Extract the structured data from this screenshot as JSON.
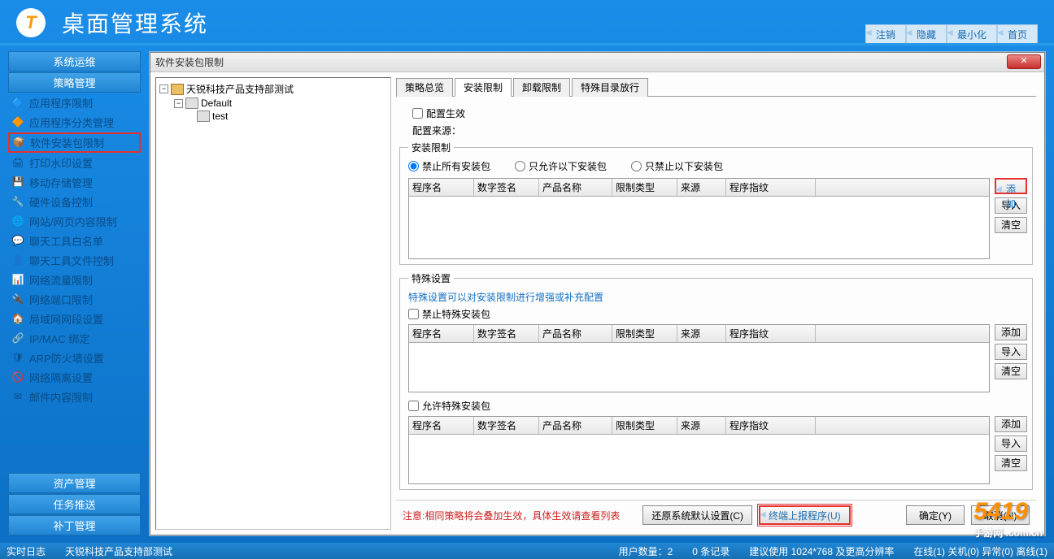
{
  "app": {
    "title": "桌面管理系统"
  },
  "header_links": [
    "注销",
    "隐藏",
    "最小化",
    "首页"
  ],
  "sidebar": {
    "top_headers": [
      "系统运维",
      "策略管理"
    ],
    "items": [
      {
        "label": "应用程序限制"
      },
      {
        "label": "应用程序分类管理"
      },
      {
        "label": "软件安装包限制",
        "highlight": true
      },
      {
        "label": "打印水印设置"
      },
      {
        "label": "移动存储管理"
      },
      {
        "label": "硬件设备控制"
      },
      {
        "label": "网站/网页内容限制"
      },
      {
        "label": "聊天工具白名单"
      },
      {
        "label": "聊天工具文件控制"
      },
      {
        "label": "网络流量限制"
      },
      {
        "label": "网络端口限制"
      },
      {
        "label": "局域网网段设置"
      },
      {
        "label": "IP/MAC 绑定"
      },
      {
        "label": "ARP防火墙设置"
      },
      {
        "label": "网络隔离设置"
      },
      {
        "label": "邮件内容限制"
      }
    ],
    "bottom_headers": [
      "资产管理",
      "任务推送",
      "补丁管理"
    ]
  },
  "dialog": {
    "title": "软件安装包限制",
    "tree": {
      "root": "天锐科技产品支持部测试",
      "child1": "Default",
      "leaf": "test"
    },
    "tabs": [
      "策略总览",
      "安装限制",
      "卸载限制",
      "特殊目录放行"
    ],
    "active_tab": 1,
    "config_effective_label": "配置生效",
    "config_source_label": "配置来源：",
    "install_restrict": {
      "legend": "安装限制",
      "radios": [
        "禁止所有安装包",
        "只允许以下安装包",
        "只禁止以下安装包"
      ],
      "selected": 0,
      "btns": [
        "添加",
        "导入",
        "清空"
      ]
    },
    "special": {
      "legend": "特殊设置",
      "hint": "特殊设置可以对安装限制进行增强或补充配置",
      "chk1": "禁止特殊安装包",
      "chk2": "允许特殊安装包",
      "btns": [
        "添加",
        "导入",
        "清空"
      ]
    },
    "columns": [
      "程序名",
      "数字签名",
      "产品名称",
      "限制类型",
      "来源",
      "程序指纹"
    ],
    "footer": {
      "note": "注意:相同策略将会叠加生效，具体生效请查看列表",
      "restore": "还原系统默认设置(C)",
      "report": "终端上报程序(U)",
      "ok": "确定(Y)",
      "cancel": "取消(N)"
    }
  },
  "status": {
    "s1": "实时日志",
    "s2": "天锐科技产品支持部测试",
    "s3": "用户数量：2",
    "s4": "0 条记录",
    "s5": "建议使用 1024*768 及更高分辨率",
    "s6": "在线(1) 关机(0) 异常(0) 离线(1)"
  },
  "watermark": {
    "big": "5419",
    "small": "手游网 .com.cn"
  }
}
